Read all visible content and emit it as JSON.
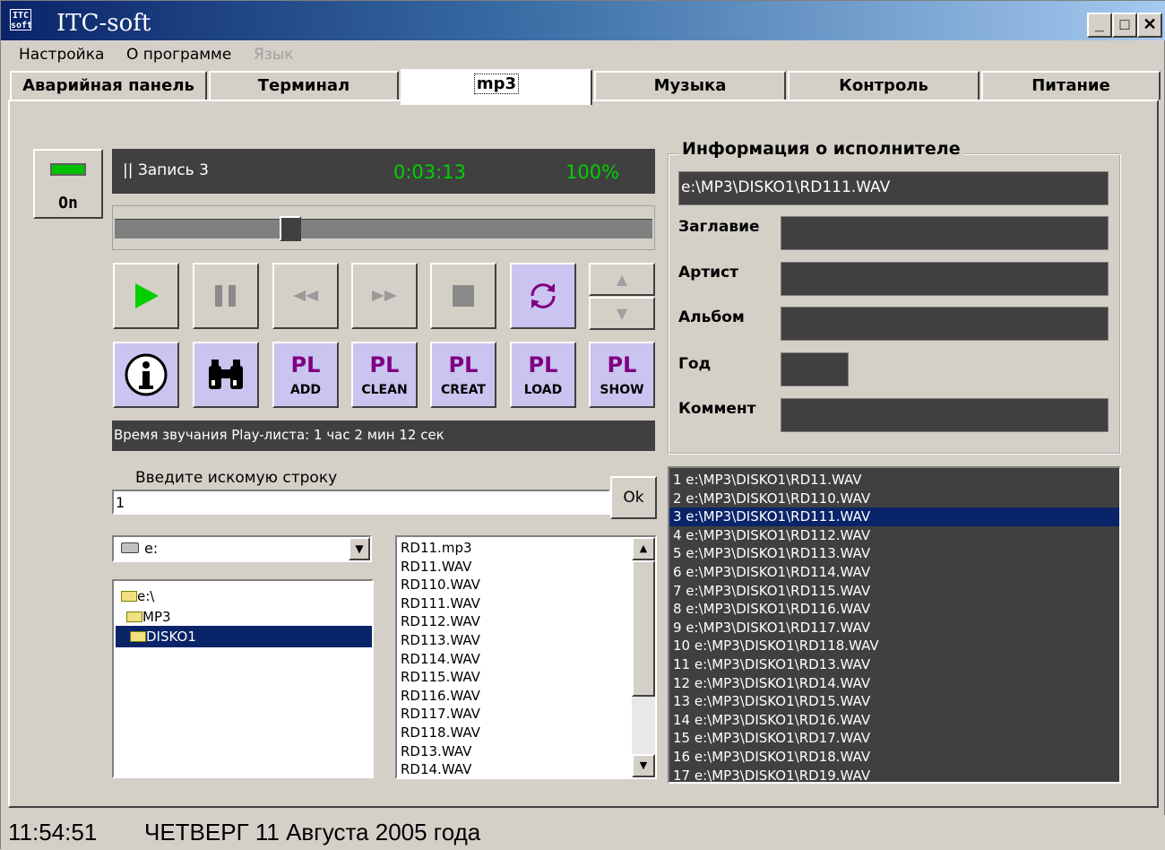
{
  "window": {
    "title": "ITC-soft",
    "icon": "itc-logo-icon",
    "logo_text": "ITC soft"
  },
  "menu": [
    "Настройка",
    "О программе",
    "Язык"
  ],
  "tabs": [
    "Аварийная панель",
    "Терминал",
    "mp3",
    "Музыка",
    "Контроль",
    "Питание"
  ],
  "power": {
    "label": "On",
    "indicator_color": "#00c000"
  },
  "player": {
    "status": "|| Запись 3",
    "time": "0:03:13",
    "volume": "100%",
    "position_fraction": 0.32,
    "text_color": "#00d000"
  },
  "controls": [
    {
      "name": "play",
      "icon": "play-icon"
    },
    {
      "name": "pause",
      "icon": "pause-icon"
    },
    {
      "name": "rewind",
      "icon": "rewind-icon"
    },
    {
      "name": "fast-forward",
      "icon": "fast-forward-icon"
    },
    {
      "name": "stop",
      "icon": "stop-icon"
    },
    {
      "name": "repeat",
      "icon": "repeat-icon"
    }
  ],
  "playlist_buttons": [
    {
      "top": "PL",
      "bottom": "ADD"
    },
    {
      "top": "PL",
      "bottom": "CLEAN"
    },
    {
      "top": "PL",
      "bottom": "CREAT"
    },
    {
      "top": "PL",
      "bottom": "LOAD"
    },
    {
      "top": "PL",
      "bottom": "SHOW"
    }
  ],
  "playlist_duration": "Время звучания Play-листа: 1 час 2 мин 12 сек",
  "search": {
    "label": "Введите искомую строку",
    "value": "1",
    "ok_label": "Ok"
  },
  "drive": {
    "value": "e:"
  },
  "folders": [
    "e:\\",
    "MP3",
    "DISKO1"
  ],
  "files": [
    "RD11.mp3",
    "RD11.WAV",
    "RD110.WAV",
    "RD111.WAV",
    "RD112.WAV",
    "RD113.WAV",
    "RD114.WAV",
    "RD115.WAV",
    "RD116.WAV",
    "RD117.WAV",
    "RD118.WAV",
    "RD13.WAV",
    "RD14.WAV"
  ],
  "info": {
    "group_label": "Информация о исполнителе",
    "file_path": "e:\\MP3\\DISKO1\\RD111.WAV",
    "fields": [
      "Заглавие",
      "Артист",
      "Альбом",
      "Год",
      "Коммент"
    ]
  },
  "playlist": [
    "1 e:\\MP3\\DISKO1\\RD11.WAV",
    "2 e:\\MP3\\DISKO1\\RD110.WAV",
    "3 e:\\MP3\\DISKO1\\RD111.WAV",
    "4 e:\\MP3\\DISKO1\\RD112.WAV",
    "5 e:\\MP3\\DISKO1\\RD113.WAV",
    "6 e:\\MP3\\DISKO1\\RD114.WAV",
    "7 e:\\MP3\\DISKO1\\RD115.WAV",
    "8 e:\\MP3\\DISKO1\\RD116.WAV",
    "9 e:\\MP3\\DISKO1\\RD117.WAV",
    "10 e:\\MP3\\DISKO1\\RD118.WAV",
    "11 e:\\MP3\\DISKO1\\RD13.WAV",
    "12 e:\\MP3\\DISKO1\\RD14.WAV",
    "13 e:\\MP3\\DISKO1\\RD15.WAV",
    "14 e:\\MP3\\DISKO1\\RD16.WAV",
    "15 e:\\MP3\\DISKO1\\RD17.WAV",
    "16 e:\\MP3\\DISKO1\\RD18.WAV",
    "17 e:\\MP3\\DISKO1\\RD19.WAV"
  ],
  "playlist_selected_index": 2,
  "status": {
    "time": "11:54:51",
    "date": "ЧЕТВЕРГ 11 Августа 2005 года"
  },
  "colors": {
    "selection": "#0a246a",
    "panel_dark": "#404040",
    "violet_button": "#c9c4f0",
    "pl_text": "#800080"
  }
}
